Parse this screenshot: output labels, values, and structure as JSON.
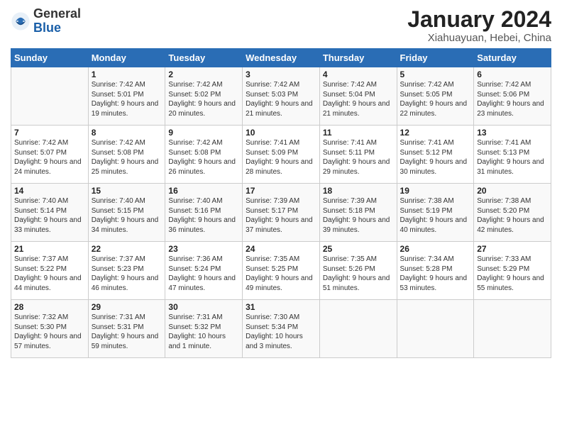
{
  "header": {
    "logo_general": "General",
    "logo_blue": "Blue",
    "title": "January 2024",
    "subtitle": "Xiahuayuan, Hebei, China"
  },
  "days_of_week": [
    "Sunday",
    "Monday",
    "Tuesday",
    "Wednesday",
    "Thursday",
    "Friday",
    "Saturday"
  ],
  "weeks": [
    [
      {
        "day": "",
        "content": ""
      },
      {
        "day": "1",
        "content": "Sunrise: 7:42 AM\nSunset: 5:01 PM\nDaylight: 9 hours\nand 19 minutes."
      },
      {
        "day": "2",
        "content": "Sunrise: 7:42 AM\nSunset: 5:02 PM\nDaylight: 9 hours\nand 20 minutes."
      },
      {
        "day": "3",
        "content": "Sunrise: 7:42 AM\nSunset: 5:03 PM\nDaylight: 9 hours\nand 21 minutes."
      },
      {
        "day": "4",
        "content": "Sunrise: 7:42 AM\nSunset: 5:04 PM\nDaylight: 9 hours\nand 21 minutes."
      },
      {
        "day": "5",
        "content": "Sunrise: 7:42 AM\nSunset: 5:05 PM\nDaylight: 9 hours\nand 22 minutes."
      },
      {
        "day": "6",
        "content": "Sunrise: 7:42 AM\nSunset: 5:06 PM\nDaylight: 9 hours\nand 23 minutes."
      }
    ],
    [
      {
        "day": "7",
        "content": "Sunrise: 7:42 AM\nSunset: 5:07 PM\nDaylight: 9 hours\nand 24 minutes."
      },
      {
        "day": "8",
        "content": "Sunrise: 7:42 AM\nSunset: 5:08 PM\nDaylight: 9 hours\nand 25 minutes."
      },
      {
        "day": "9",
        "content": "Sunrise: 7:42 AM\nSunset: 5:08 PM\nDaylight: 9 hours\nand 26 minutes."
      },
      {
        "day": "10",
        "content": "Sunrise: 7:41 AM\nSunset: 5:09 PM\nDaylight: 9 hours\nand 28 minutes."
      },
      {
        "day": "11",
        "content": "Sunrise: 7:41 AM\nSunset: 5:11 PM\nDaylight: 9 hours\nand 29 minutes."
      },
      {
        "day": "12",
        "content": "Sunrise: 7:41 AM\nSunset: 5:12 PM\nDaylight: 9 hours\nand 30 minutes."
      },
      {
        "day": "13",
        "content": "Sunrise: 7:41 AM\nSunset: 5:13 PM\nDaylight: 9 hours\nand 31 minutes."
      }
    ],
    [
      {
        "day": "14",
        "content": "Sunrise: 7:40 AM\nSunset: 5:14 PM\nDaylight: 9 hours\nand 33 minutes."
      },
      {
        "day": "15",
        "content": "Sunrise: 7:40 AM\nSunset: 5:15 PM\nDaylight: 9 hours\nand 34 minutes."
      },
      {
        "day": "16",
        "content": "Sunrise: 7:40 AM\nSunset: 5:16 PM\nDaylight: 9 hours\nand 36 minutes."
      },
      {
        "day": "17",
        "content": "Sunrise: 7:39 AM\nSunset: 5:17 PM\nDaylight: 9 hours\nand 37 minutes."
      },
      {
        "day": "18",
        "content": "Sunrise: 7:39 AM\nSunset: 5:18 PM\nDaylight: 9 hours\nand 39 minutes."
      },
      {
        "day": "19",
        "content": "Sunrise: 7:38 AM\nSunset: 5:19 PM\nDaylight: 9 hours\nand 40 minutes."
      },
      {
        "day": "20",
        "content": "Sunrise: 7:38 AM\nSunset: 5:20 PM\nDaylight: 9 hours\nand 42 minutes."
      }
    ],
    [
      {
        "day": "21",
        "content": "Sunrise: 7:37 AM\nSunset: 5:22 PM\nDaylight: 9 hours\nand 44 minutes."
      },
      {
        "day": "22",
        "content": "Sunrise: 7:37 AM\nSunset: 5:23 PM\nDaylight: 9 hours\nand 46 minutes."
      },
      {
        "day": "23",
        "content": "Sunrise: 7:36 AM\nSunset: 5:24 PM\nDaylight: 9 hours\nand 47 minutes."
      },
      {
        "day": "24",
        "content": "Sunrise: 7:35 AM\nSunset: 5:25 PM\nDaylight: 9 hours\nand 49 minutes."
      },
      {
        "day": "25",
        "content": "Sunrise: 7:35 AM\nSunset: 5:26 PM\nDaylight: 9 hours\nand 51 minutes."
      },
      {
        "day": "26",
        "content": "Sunrise: 7:34 AM\nSunset: 5:28 PM\nDaylight: 9 hours\nand 53 minutes."
      },
      {
        "day": "27",
        "content": "Sunrise: 7:33 AM\nSunset: 5:29 PM\nDaylight: 9 hours\nand 55 minutes."
      }
    ],
    [
      {
        "day": "28",
        "content": "Sunrise: 7:32 AM\nSunset: 5:30 PM\nDaylight: 9 hours\nand 57 minutes."
      },
      {
        "day": "29",
        "content": "Sunrise: 7:31 AM\nSunset: 5:31 PM\nDaylight: 9 hours\nand 59 minutes."
      },
      {
        "day": "30",
        "content": "Sunrise: 7:31 AM\nSunset: 5:32 PM\nDaylight: 10 hours\nand 1 minute."
      },
      {
        "day": "31",
        "content": "Sunrise: 7:30 AM\nSunset: 5:34 PM\nDaylight: 10 hours\nand 3 minutes."
      },
      {
        "day": "",
        "content": ""
      },
      {
        "day": "",
        "content": ""
      },
      {
        "day": "",
        "content": ""
      }
    ]
  ]
}
